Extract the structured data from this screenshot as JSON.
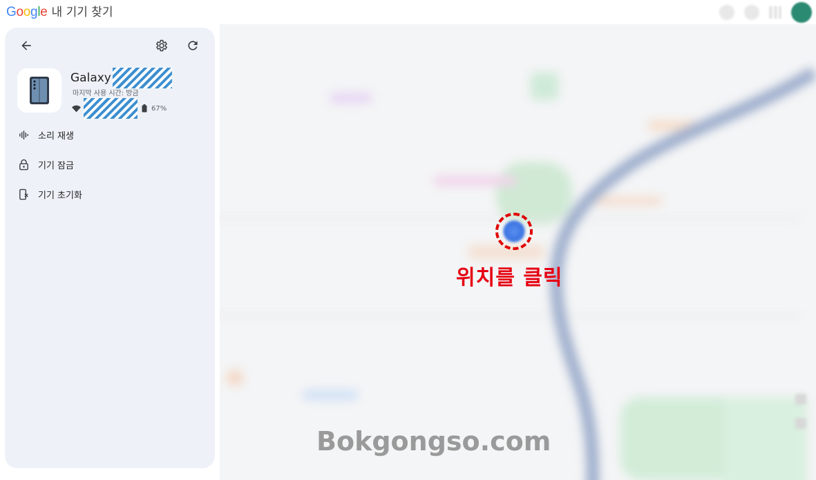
{
  "header": {
    "brand_letters": [
      {
        "char": "G",
        "color": "#4285F4"
      },
      {
        "char": "o",
        "color": "#EA4335"
      },
      {
        "char": "o",
        "color": "#FBBC05"
      },
      {
        "char": "g",
        "color": "#4285F4"
      },
      {
        "char": "l",
        "color": "#34A853"
      },
      {
        "char": "e",
        "color": "#EA4335"
      }
    ],
    "title": "내 기기 찾기"
  },
  "panel": {
    "back_icon": "arrow-left-icon",
    "settings_icon": "gear-icon",
    "refresh_icon": "refresh-icon",
    "device": {
      "name": "Galaxy",
      "last_used": "마지막 사용 시간: 방금",
      "battery": "67%"
    },
    "actions": [
      {
        "label": "소리 재생",
        "icon": "sound-wave-icon"
      },
      {
        "label": "기기 잠금",
        "icon": "lock-icon"
      },
      {
        "label": "기기 초기화",
        "icon": "phone-erase-icon"
      }
    ]
  },
  "map": {
    "callout": "위치를 클릭",
    "watermark": "Bokgongso.com",
    "location_color": "#3d75e2",
    "callout_color": "#e60012"
  }
}
